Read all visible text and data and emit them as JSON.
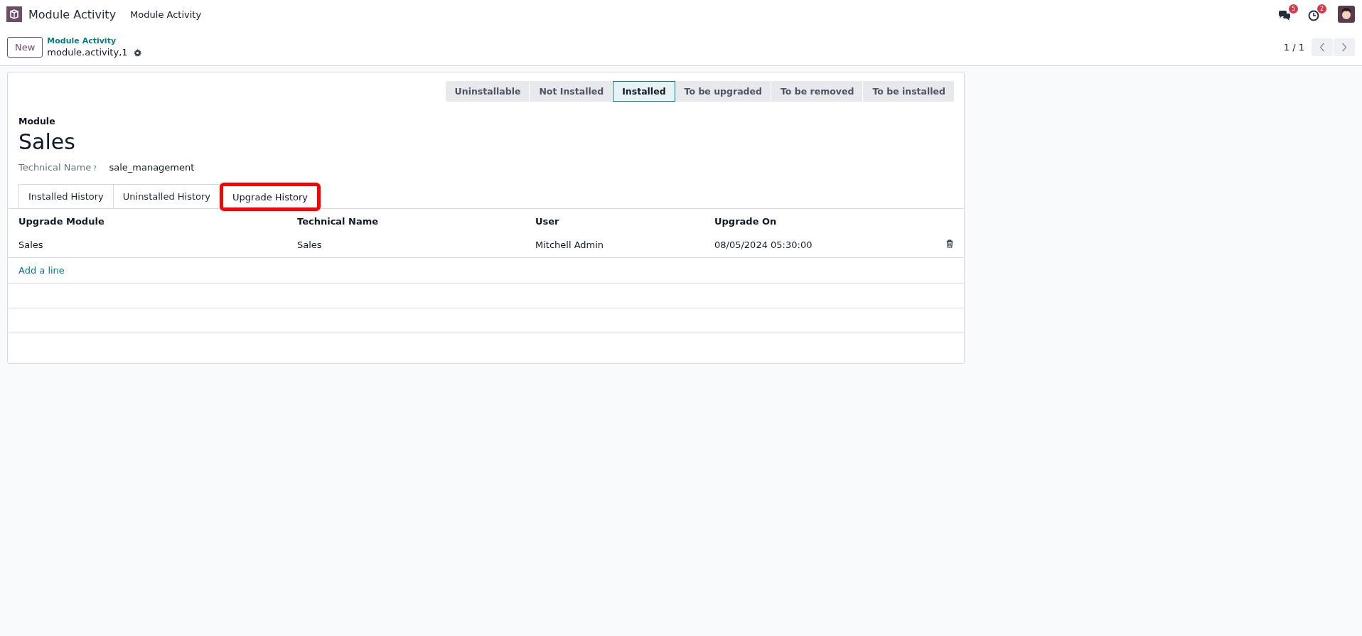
{
  "navbar": {
    "app_name": "Module Activity",
    "menu": [
      "Module Activity"
    ],
    "messages_badge": "5",
    "activities_badge": "2"
  },
  "control_panel": {
    "new_button": "New",
    "breadcrumb": "Module Activity",
    "record": "module.activity,1",
    "pager": "1 / 1"
  },
  "statusbar": [
    {
      "label": "Uninstallable",
      "selected": false
    },
    {
      "label": "Not Installed",
      "selected": false
    },
    {
      "label": "Installed",
      "selected": true
    },
    {
      "label": "To be upgraded",
      "selected": false
    },
    {
      "label": "To be removed",
      "selected": false
    },
    {
      "label": "To be installed",
      "selected": false
    }
  ],
  "form": {
    "label": "Module",
    "title": "Sales",
    "field_label": "Technical Name",
    "field_help": "?",
    "field_value": "sale_management"
  },
  "tabs": [
    {
      "label": "Installed History",
      "selected": false,
      "highlighted": false
    },
    {
      "label": "Uninstalled History",
      "selected": false,
      "highlighted": false
    },
    {
      "label": "Upgrade History",
      "selected": true,
      "highlighted": true
    }
  ],
  "table": {
    "columns": [
      "Upgrade Module",
      "Technical Name",
      "User",
      "Upgrade On"
    ],
    "rows": [
      [
        "Sales",
        "Sales",
        "Mitchell Admin",
        "08/05/2024 05:30:00"
      ]
    ],
    "add_line": "Add a line"
  }
}
